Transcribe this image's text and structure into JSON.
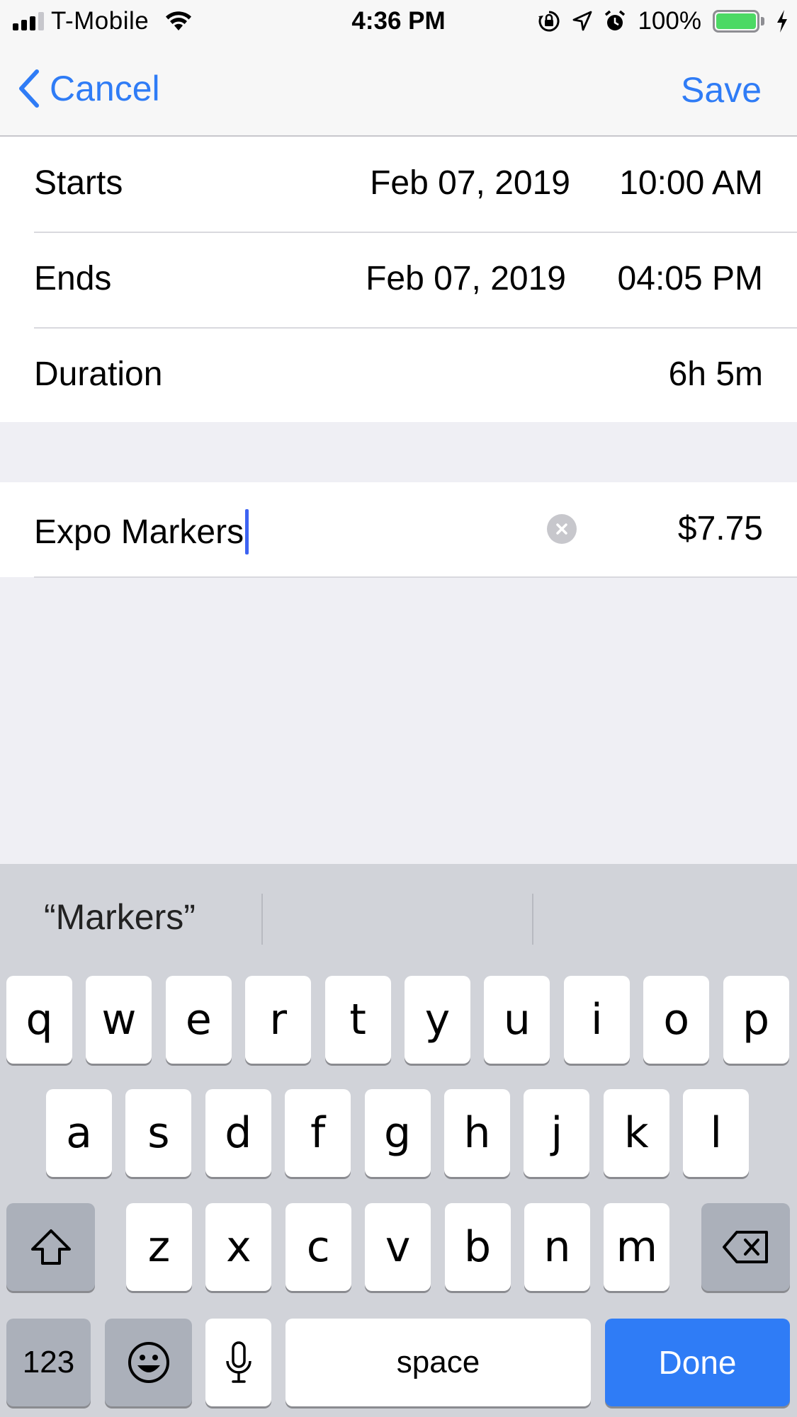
{
  "status_bar": {
    "carrier": "T-Mobile",
    "time": "4:36 PM",
    "battery": "100%",
    "battery_color": "#4cd964"
  },
  "nav": {
    "back_label": "Cancel",
    "save_label": "Save",
    "accent": "#2f7cf6"
  },
  "schedule": {
    "starts_label": "Starts",
    "starts_date": "Feb 07, 2019",
    "starts_time": "10:00 AM",
    "ends_label": "Ends",
    "ends_date": "Feb 07, 2019",
    "ends_time": "04:05 PM",
    "duration_label": "Duration",
    "duration_value": "6h 5m"
  },
  "item": {
    "name": "Expo Markers",
    "price": "$7.75"
  },
  "keyboard": {
    "suggestion": "“Markers”",
    "row1": [
      "q",
      "w",
      "e",
      "r",
      "t",
      "y",
      "u",
      "i",
      "o",
      "p"
    ],
    "row2": [
      "a",
      "s",
      "d",
      "f",
      "g",
      "h",
      "j",
      "k",
      "l"
    ],
    "row3": [
      "z",
      "x",
      "c",
      "v",
      "b",
      "n",
      "m"
    ],
    "numbers_label": "123",
    "space_label": "space",
    "done_label": "Done"
  }
}
